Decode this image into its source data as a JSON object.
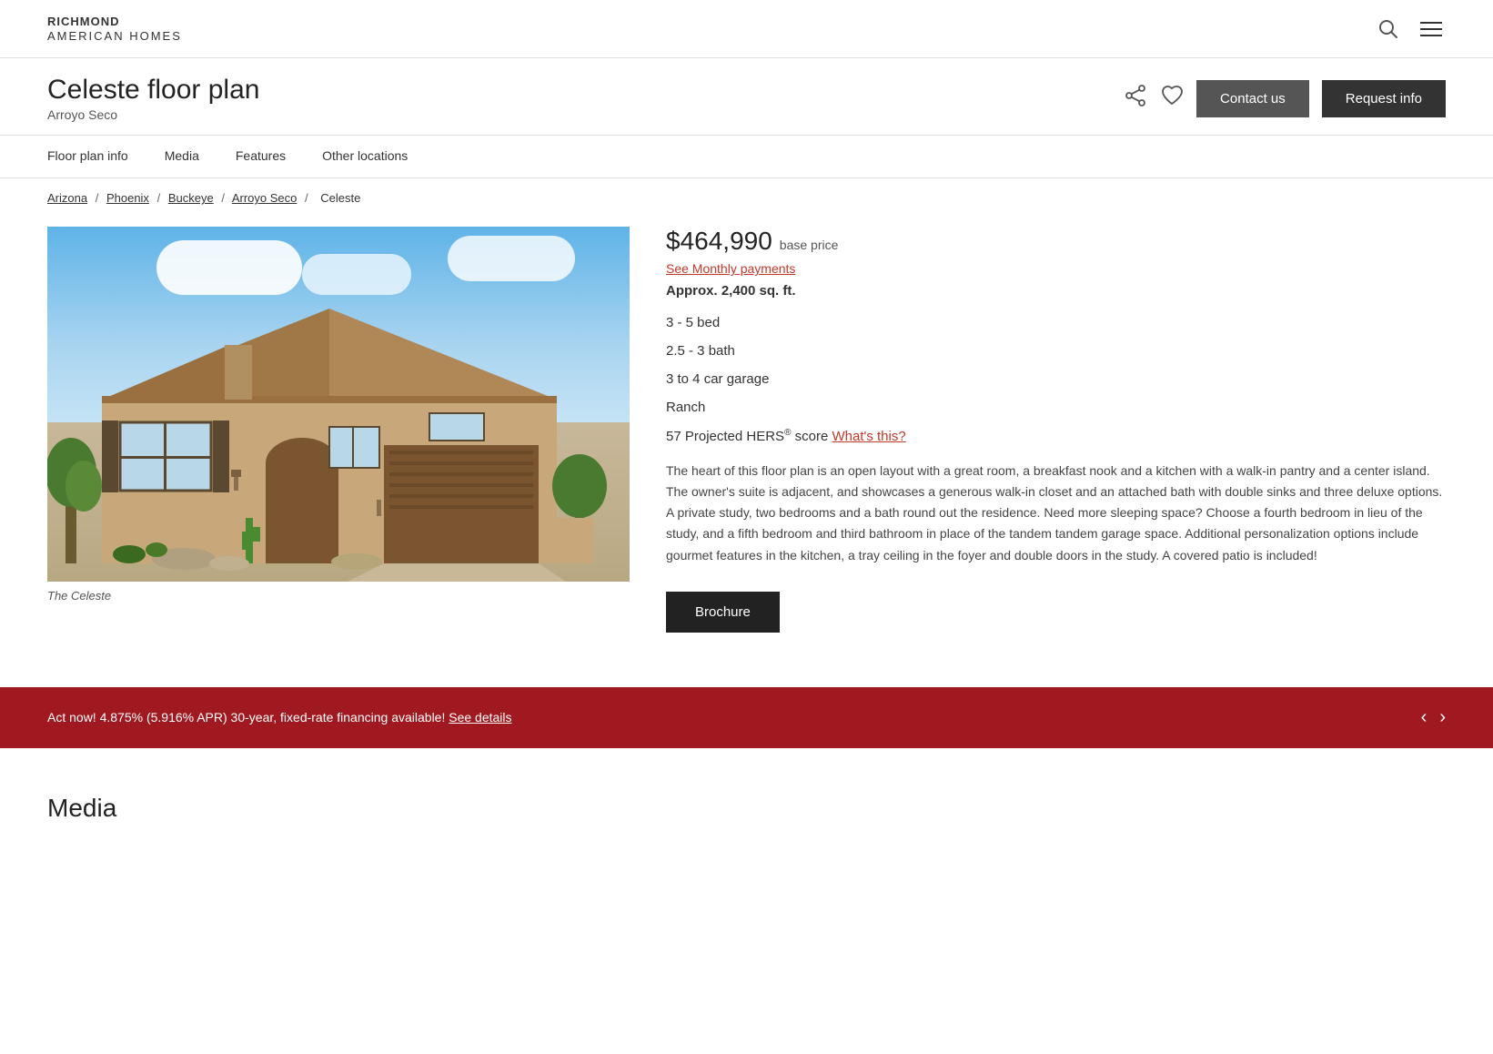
{
  "brand": {
    "name_line1": "RICHMOND",
    "name_line2": "AMERICAN HOMES"
  },
  "header": {
    "contact_us_label": "Contact us",
    "request_info_label": "Request info"
  },
  "floor_plan": {
    "title": "Celeste floor plan",
    "subtitle": "Arroyo Seco",
    "price": "$464,990",
    "base_price_label": "base price",
    "monthly_payments_label": "See Monthly payments",
    "sqft": "Approx. 2,400 sq. ft.",
    "bed": "3 - 5 bed",
    "bath": "2.5 - 3 bath",
    "garage": "3 to 4 car garage",
    "style": "Ranch",
    "hers_score": "57 Projected HERS",
    "hers_super": "®",
    "hers_label": " score ",
    "whats_this": "What's this?",
    "description": "The heart of this floor plan is an open layout with a great room, a breakfast nook and a kitchen with a walk-in pantry and a center island. The owner's suite is adjacent, and showcases a generous walk-in closet and an attached bath with double sinks and three deluxe options. A private study, two bedrooms and a bath round out the residence. Need more sleeping space? Choose a fourth bedroom in lieu of the study, and a fifth bedroom and third bathroom in place of the tandem tandem garage space. Additional personalization options include gourmet features in the kitchen, a tray ceiling in the foyer and double doors in the study. A covered patio is included!",
    "image_caption": "The Celeste",
    "brochure_label": "Brochure"
  },
  "nav": {
    "tabs": [
      {
        "label": "Floor plan info",
        "id": "floor-plan-info"
      },
      {
        "label": "Media",
        "id": "media"
      },
      {
        "label": "Features",
        "id": "features"
      },
      {
        "label": "Other locations",
        "id": "other-locations"
      }
    ]
  },
  "breadcrumb": {
    "items": [
      {
        "label": "Arizona",
        "href": "#"
      },
      {
        "label": "Phoenix",
        "href": "#"
      },
      {
        "label": "Buckeye",
        "href": "#"
      },
      {
        "label": "Arroyo Seco",
        "href": "#"
      },
      {
        "label": "Celeste",
        "current": true
      }
    ]
  },
  "promo": {
    "text": "Act now! 4.875% (5.916% APR) 30-year, fixed-rate financing available!",
    "link_label": "See details"
  },
  "media_section": {
    "title": "Media"
  }
}
